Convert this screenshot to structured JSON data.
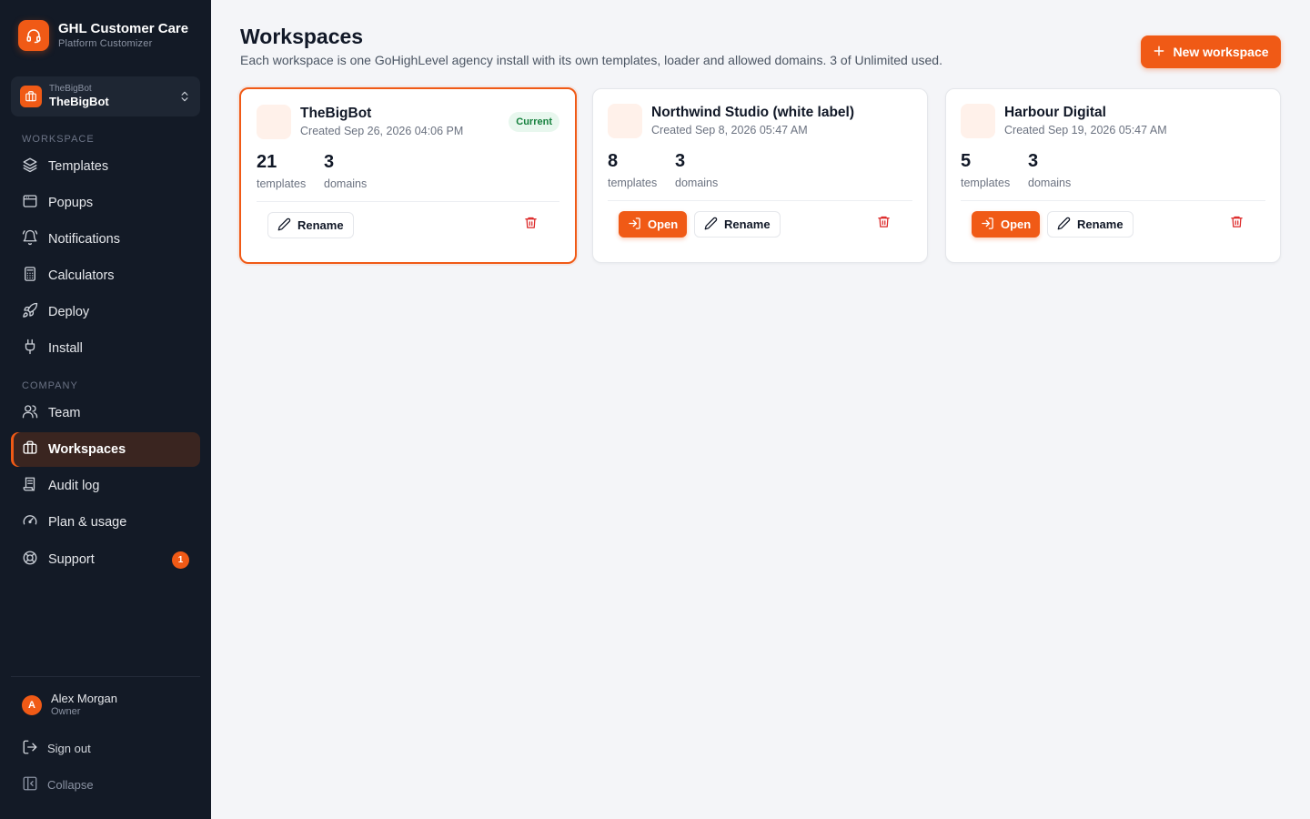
{
  "brand": {
    "title": "GHL Customer Care",
    "subtitle": "Platform Customizer"
  },
  "workspace_switcher": {
    "small_label": "TheBigBot",
    "name": "TheBigBot"
  },
  "sidebar": {
    "section_workspace": "WORKSPACE",
    "workspace_items": [
      {
        "label": "Templates",
        "icon": "layers-icon"
      },
      {
        "label": "Popups",
        "icon": "window-icon"
      },
      {
        "label": "Notifications",
        "icon": "bell-icon"
      },
      {
        "label": "Calculators",
        "icon": "calculator-icon"
      },
      {
        "label": "Deploy",
        "icon": "rocket-icon"
      },
      {
        "label": "Install",
        "icon": "plug-icon"
      }
    ],
    "section_company": "COMPANY",
    "company_items": [
      {
        "label": "Team",
        "icon": "users-icon"
      },
      {
        "label": "Workspaces",
        "icon": "briefcase-icon",
        "active": true
      },
      {
        "label": "Audit log",
        "icon": "log-icon"
      },
      {
        "label": "Plan & usage",
        "icon": "gauge-icon"
      },
      {
        "label": "Support",
        "icon": "lifebuoy-icon",
        "badge": "1"
      }
    ],
    "user": {
      "initial": "A",
      "name": "Alex Morgan",
      "role": "Owner"
    },
    "sign_out": "Sign out",
    "collapse": "Collapse"
  },
  "header": {
    "title": "Workspaces",
    "subtitle": "Each workspace is one GoHighLevel agency install with its own templates, loader and allowed domains. 3 of Unlimited used.",
    "new_button": "New workspace"
  },
  "workspaces": [
    {
      "name": "TheBigBot",
      "created": "Created Sep 26, 2026 04:06 PM",
      "templates": "21",
      "templates_label": "templates",
      "domains": "3",
      "domains_label": "domains",
      "current_badge": "Current",
      "rename_label": "Rename"
    },
    {
      "name": "Northwind Studio (white label)",
      "created": "Created Sep 8, 2026 05:47 AM",
      "templates": "8",
      "templates_label": "templates",
      "domains": "3",
      "domains_label": "domains",
      "open_label": "Open",
      "rename_label": "Rename"
    },
    {
      "name": "Harbour Digital",
      "created": "Created Sep 19, 2026 05:47 AM",
      "templates": "5",
      "templates_label": "templates",
      "domains": "3",
      "domains_label": "domains",
      "open_label": "Open",
      "rename_label": "Rename"
    }
  ],
  "colors": {
    "accent": "#f05a16",
    "sidebar_bg": "#131a26",
    "page_bg": "#f4f5f8",
    "success": "#15803d"
  }
}
